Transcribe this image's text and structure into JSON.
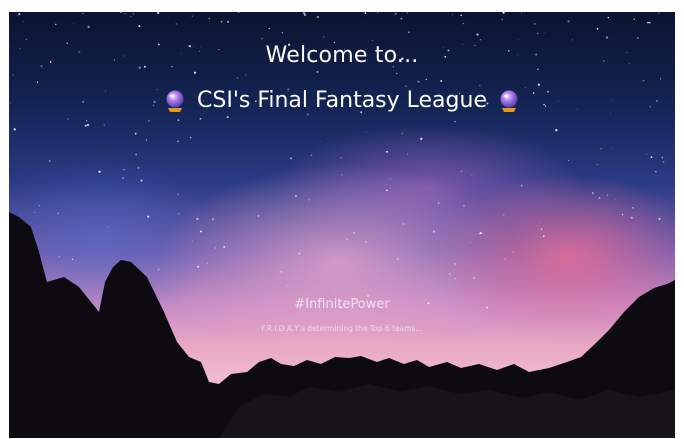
{
  "hero": {
    "welcome_text": "Welcome to...",
    "league_name": "CSI's Final Fantasy League",
    "left_icon": "crystal-ball-icon",
    "right_icon": "crystal-ball-icon",
    "tagline": "#InfinitePower",
    "status_text": "F.R.I.D.A.Y's determining the Top 6 teams..."
  },
  "colors": {
    "text": "#ffffff",
    "sky_top": "#0b1330",
    "horizon_pink": "#e7a7c5",
    "orb_purple": "#8a6ad6",
    "orb_base": "#e39a1f"
  }
}
